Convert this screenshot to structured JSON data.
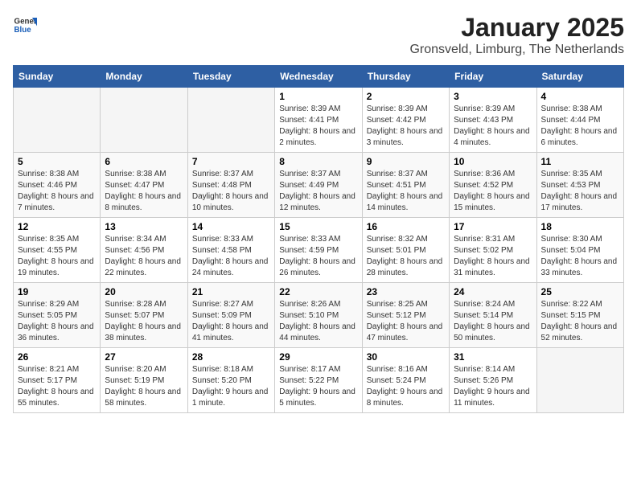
{
  "logo": {
    "general": "General",
    "blue": "Blue"
  },
  "title": "January 2025",
  "location": "Gronsveld, Limburg, The Netherlands",
  "weekdays": [
    "Sunday",
    "Monday",
    "Tuesday",
    "Wednesday",
    "Thursday",
    "Friday",
    "Saturday"
  ],
  "weeks": [
    [
      {
        "day": "",
        "info": ""
      },
      {
        "day": "",
        "info": ""
      },
      {
        "day": "",
        "info": ""
      },
      {
        "day": "1",
        "info": "Sunrise: 8:39 AM\nSunset: 4:41 PM\nDaylight: 8 hours and 2 minutes."
      },
      {
        "day": "2",
        "info": "Sunrise: 8:39 AM\nSunset: 4:42 PM\nDaylight: 8 hours and 3 minutes."
      },
      {
        "day": "3",
        "info": "Sunrise: 8:39 AM\nSunset: 4:43 PM\nDaylight: 8 hours and 4 minutes."
      },
      {
        "day": "4",
        "info": "Sunrise: 8:38 AM\nSunset: 4:44 PM\nDaylight: 8 hours and 6 minutes."
      }
    ],
    [
      {
        "day": "5",
        "info": "Sunrise: 8:38 AM\nSunset: 4:46 PM\nDaylight: 8 hours and 7 minutes."
      },
      {
        "day": "6",
        "info": "Sunrise: 8:38 AM\nSunset: 4:47 PM\nDaylight: 8 hours and 8 minutes."
      },
      {
        "day": "7",
        "info": "Sunrise: 8:37 AM\nSunset: 4:48 PM\nDaylight: 8 hours and 10 minutes."
      },
      {
        "day": "8",
        "info": "Sunrise: 8:37 AM\nSunset: 4:49 PM\nDaylight: 8 hours and 12 minutes."
      },
      {
        "day": "9",
        "info": "Sunrise: 8:37 AM\nSunset: 4:51 PM\nDaylight: 8 hours and 14 minutes."
      },
      {
        "day": "10",
        "info": "Sunrise: 8:36 AM\nSunset: 4:52 PM\nDaylight: 8 hours and 15 minutes."
      },
      {
        "day": "11",
        "info": "Sunrise: 8:35 AM\nSunset: 4:53 PM\nDaylight: 8 hours and 17 minutes."
      }
    ],
    [
      {
        "day": "12",
        "info": "Sunrise: 8:35 AM\nSunset: 4:55 PM\nDaylight: 8 hours and 19 minutes."
      },
      {
        "day": "13",
        "info": "Sunrise: 8:34 AM\nSunset: 4:56 PM\nDaylight: 8 hours and 22 minutes."
      },
      {
        "day": "14",
        "info": "Sunrise: 8:33 AM\nSunset: 4:58 PM\nDaylight: 8 hours and 24 minutes."
      },
      {
        "day": "15",
        "info": "Sunrise: 8:33 AM\nSunset: 4:59 PM\nDaylight: 8 hours and 26 minutes."
      },
      {
        "day": "16",
        "info": "Sunrise: 8:32 AM\nSunset: 5:01 PM\nDaylight: 8 hours and 28 minutes."
      },
      {
        "day": "17",
        "info": "Sunrise: 8:31 AM\nSunset: 5:02 PM\nDaylight: 8 hours and 31 minutes."
      },
      {
        "day": "18",
        "info": "Sunrise: 8:30 AM\nSunset: 5:04 PM\nDaylight: 8 hours and 33 minutes."
      }
    ],
    [
      {
        "day": "19",
        "info": "Sunrise: 8:29 AM\nSunset: 5:05 PM\nDaylight: 8 hours and 36 minutes."
      },
      {
        "day": "20",
        "info": "Sunrise: 8:28 AM\nSunset: 5:07 PM\nDaylight: 8 hours and 38 minutes."
      },
      {
        "day": "21",
        "info": "Sunrise: 8:27 AM\nSunset: 5:09 PM\nDaylight: 8 hours and 41 minutes."
      },
      {
        "day": "22",
        "info": "Sunrise: 8:26 AM\nSunset: 5:10 PM\nDaylight: 8 hours and 44 minutes."
      },
      {
        "day": "23",
        "info": "Sunrise: 8:25 AM\nSunset: 5:12 PM\nDaylight: 8 hours and 47 minutes."
      },
      {
        "day": "24",
        "info": "Sunrise: 8:24 AM\nSunset: 5:14 PM\nDaylight: 8 hours and 50 minutes."
      },
      {
        "day": "25",
        "info": "Sunrise: 8:22 AM\nSunset: 5:15 PM\nDaylight: 8 hours and 52 minutes."
      }
    ],
    [
      {
        "day": "26",
        "info": "Sunrise: 8:21 AM\nSunset: 5:17 PM\nDaylight: 8 hours and 55 minutes."
      },
      {
        "day": "27",
        "info": "Sunrise: 8:20 AM\nSunset: 5:19 PM\nDaylight: 8 hours and 58 minutes."
      },
      {
        "day": "28",
        "info": "Sunrise: 8:18 AM\nSunset: 5:20 PM\nDaylight: 9 hours and 1 minute."
      },
      {
        "day": "29",
        "info": "Sunrise: 8:17 AM\nSunset: 5:22 PM\nDaylight: 9 hours and 5 minutes."
      },
      {
        "day": "30",
        "info": "Sunrise: 8:16 AM\nSunset: 5:24 PM\nDaylight: 9 hours and 8 minutes."
      },
      {
        "day": "31",
        "info": "Sunrise: 8:14 AM\nSunset: 5:26 PM\nDaylight: 9 hours and 11 minutes."
      },
      {
        "day": "",
        "info": ""
      }
    ]
  ]
}
